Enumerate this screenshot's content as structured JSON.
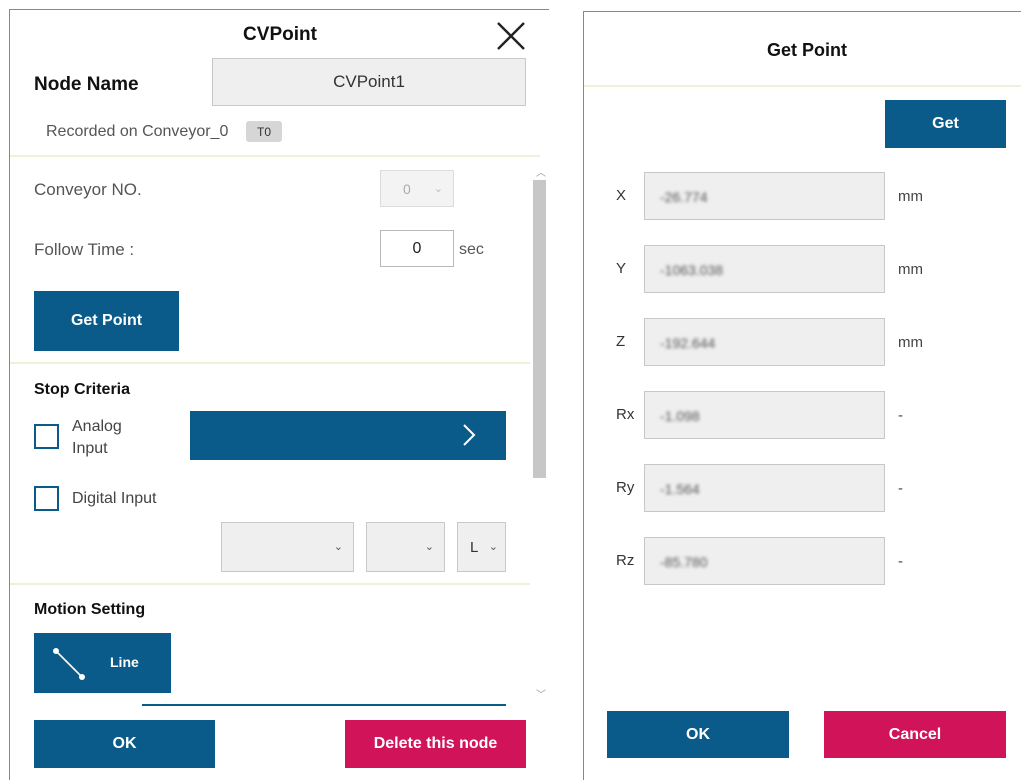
{
  "cvpoint": {
    "title": "CVPoint",
    "node_name_label": "Node Name",
    "node_name_value": "CVPoint1",
    "recorded_text": "Recorded on Conveyor_0",
    "tool_badge": "T0",
    "conveyor_no_label": "Conveyor NO.",
    "conveyor_no_value": "0",
    "follow_time_label": "Follow Time :",
    "follow_time_value": "0",
    "follow_time_unit": "sec",
    "get_point_button": "Get Point",
    "stop_criteria_heading": "Stop Criteria",
    "analog_input_label": "Analog Input",
    "digital_input_label": "Digital Input",
    "digital_dropdown_3_value": "L",
    "motion_setting_heading": "Motion Setting",
    "line_button": "Line",
    "ok_button": "OK",
    "delete_button": "Delete this node"
  },
  "get_point": {
    "title": "Get Point",
    "get_button": "Get",
    "rows": [
      {
        "axis": "X",
        "value": "-26.774",
        "unit": "mm"
      },
      {
        "axis": "Y",
        "value": "-1063.038",
        "unit": "mm"
      },
      {
        "axis": "Z",
        "value": "-192.644",
        "unit": "mm"
      },
      {
        "axis": "Rx",
        "value": "-1.098",
        "unit": "-"
      },
      {
        "axis": "Ry",
        "value": "-1.564",
        "unit": "-"
      },
      {
        "axis": "Rz",
        "value": "-85.780",
        "unit": "-"
      }
    ],
    "ok_button": "OK",
    "cancel_button": "Cancel"
  },
  "colors": {
    "primary_blue": "#0a5a8a",
    "danger_pink": "#d1145a",
    "separator": "#f1f0d8"
  }
}
